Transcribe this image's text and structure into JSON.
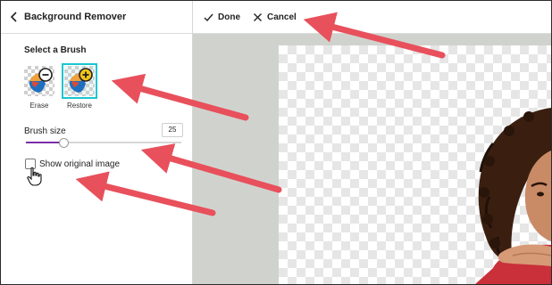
{
  "panel": {
    "back_icon": "chevron-left-icon",
    "title": "Background Remover",
    "section_title": "Select a Brush",
    "brushes": [
      {
        "label": "Erase",
        "icon": "erase-brush-icon",
        "selected": false
      },
      {
        "label": "Restore",
        "icon": "restore-brush-icon",
        "selected": true
      }
    ],
    "brush_size_label": "Brush size",
    "brush_size_value": "25",
    "brush_size_fraction": 0.24,
    "show_original_label": "Show original image",
    "show_original_checked": false
  },
  "toolbar": {
    "done_icon": "check-icon",
    "done_label": "Done",
    "cancel_icon": "close-icon",
    "cancel_label": "Cancel"
  },
  "colors": {
    "accent": "#19c6cf",
    "slider": "#7b2ea8",
    "annotation_arrow": "#e8505b",
    "canvas_bg": "#d0d3cd"
  }
}
